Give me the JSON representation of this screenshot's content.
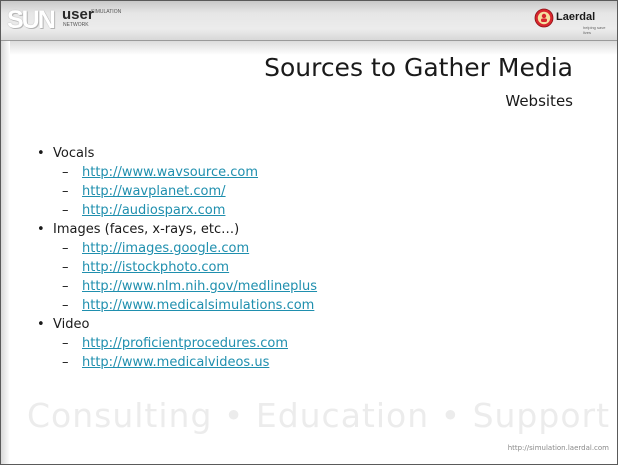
{
  "header": {
    "logo_left": {
      "mark": "SUN",
      "word": "user",
      "line1": "SIMULATION",
      "line2": "NETWORK"
    },
    "logo_right": {
      "name": "Laerdal",
      "tagline": "helping save lives"
    }
  },
  "slide": {
    "title": "Sources to Gather Media",
    "subtitle": "Websites",
    "sections": [
      {
        "label": "Vocals",
        "links": [
          "http://www.wavsource.com",
          "http://wavplanet.com/",
          "http://audiosparx.com"
        ]
      },
      {
        "label": "Images (faces, x-rays, etc…)",
        "links": [
          "http://images.google.com",
          "http://istockphoto.com",
          "http://www.nlm.nih.gov/medlineplus",
          "http://www.medicalsimulations.com"
        ]
      },
      {
        "label": "Video",
        "links": [
          "http://proficientprocedures.com",
          "http://www.medicalvideos.us"
        ]
      }
    ],
    "bullet": "•",
    "dash": "–"
  },
  "footer": {
    "watermark": "Consulting  •  Education  •  Support",
    "url": "http://simulation.laerdal.com"
  },
  "colors": {
    "link": "#1f8fae",
    "text": "#1a1a1a",
    "band": "#e6e6e6"
  }
}
